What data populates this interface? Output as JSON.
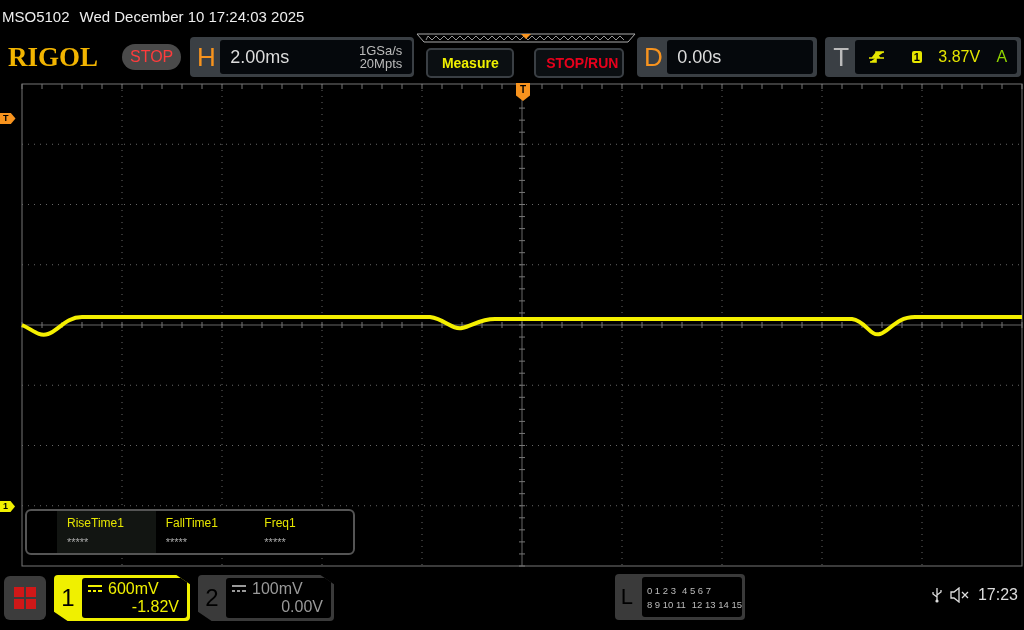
{
  "status_line": {
    "model": "MSO5102",
    "datetime": "Wed December 10 17:24:03 2025"
  },
  "logo": "RIGOL",
  "run_state": "STOP",
  "horizontal": {
    "label": "H",
    "timebase": "2.00ms",
    "sample_rate": "1GSa/s",
    "memory_depth": "20Mpts"
  },
  "buttons": [
    {
      "label": "Measure",
      "kind": "measure"
    },
    {
      "label": "STOP/RUN",
      "kind": "run"
    }
  ],
  "delay": {
    "label": "D",
    "value": "0.00s"
  },
  "trigger": {
    "label": "T",
    "source": "1",
    "trigger_level": "3.87V",
    "mode": "A"
  },
  "top_trigger_marker": "T",
  "markers": [
    {
      "label": "T",
      "kind": "trigger"
    },
    {
      "label": "1",
      "kind": "channel"
    }
  ],
  "measurements": [
    {
      "name": "RiseTime1",
      "value": "*****"
    },
    {
      "name": "FallTime1",
      "value": "*****"
    },
    {
      "name": "Freq1",
      "value": "*****"
    }
  ],
  "channels": [
    {
      "number": "1",
      "scale": "600mV",
      "offset": "-1.82V",
      "selected": true
    },
    {
      "number": "2",
      "scale": "100mV",
      "offset": "0.00V",
      "selected": false
    }
  ],
  "logic": {
    "label": "L",
    "rows": [
      [
        "0 1 2 3",
        "4 5 6 7"
      ],
      [
        "8 9 10 11",
        "12 13 14 15"
      ]
    ]
  },
  "clock": "17:23"
}
